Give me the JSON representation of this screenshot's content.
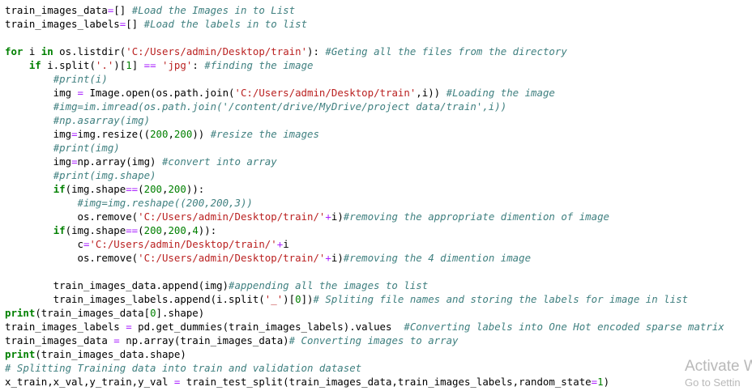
{
  "colors": {
    "background": "#ffffff",
    "comment": "#408080",
    "keyword": "#008000",
    "string": "#ba2121",
    "number": "#008000",
    "operator": "#aa22ff",
    "text": "#000000",
    "watermark": "#b9b9b9"
  },
  "code_lines": [
    [
      [
        "txt",
        "train_images_data"
      ],
      [
        "op",
        "="
      ],
      [
        "txt",
        "[] "
      ],
      [
        "cmt",
        "#Load the Images in to List"
      ]
    ],
    [
      [
        "txt",
        "train_images_labels"
      ],
      [
        "op",
        "="
      ],
      [
        "txt",
        "[] "
      ],
      [
        "cmt",
        "#Load the labels in to list"
      ]
    ],
    [],
    [
      [
        "kw",
        "for"
      ],
      [
        "txt",
        " i "
      ],
      [
        "kw",
        "in"
      ],
      [
        "txt",
        " os.listdir("
      ],
      [
        "str",
        "'C:/Users/admin/Desktop/train'"
      ],
      [
        "txt",
        "): "
      ],
      [
        "cmt",
        "#Geting all the files from the directory"
      ]
    ],
    [
      [
        "txt",
        "    "
      ],
      [
        "kw",
        "if"
      ],
      [
        "txt",
        " i.split("
      ],
      [
        "str",
        "'.'"
      ],
      [
        "txt",
        ")["
      ],
      [
        "num",
        "1"
      ],
      [
        "txt",
        "] "
      ],
      [
        "op",
        "=="
      ],
      [
        "txt",
        " "
      ],
      [
        "str",
        "'jpg'"
      ],
      [
        "txt",
        ": "
      ],
      [
        "cmt",
        "#finding the image"
      ]
    ],
    [
      [
        "txt",
        "        "
      ],
      [
        "cmt",
        "#print(i)"
      ]
    ],
    [
      [
        "txt",
        "        img "
      ],
      [
        "op",
        "="
      ],
      [
        "txt",
        " Image.open(os.path.join("
      ],
      [
        "str",
        "'C:/Users/admin/Desktop/train'"
      ],
      [
        "txt",
        ",i)) "
      ],
      [
        "cmt",
        "#Loading the image"
      ]
    ],
    [
      [
        "txt",
        "        "
      ],
      [
        "cmt",
        "#img=im.imread(os.path.join('/content/drive/MyDrive/project data/train',i))"
      ]
    ],
    [
      [
        "txt",
        "        "
      ],
      [
        "cmt",
        "#np.asarray(img)"
      ]
    ],
    [
      [
        "txt",
        "        img"
      ],
      [
        "op",
        "="
      ],
      [
        "txt",
        "img.resize(("
      ],
      [
        "num",
        "200"
      ],
      [
        "txt",
        ","
      ],
      [
        "num",
        "200"
      ],
      [
        "txt",
        ")) "
      ],
      [
        "cmt",
        "#resize the images"
      ]
    ],
    [
      [
        "txt",
        "        "
      ],
      [
        "cmt",
        "#print(img)"
      ]
    ],
    [
      [
        "txt",
        "        img"
      ],
      [
        "op",
        "="
      ],
      [
        "txt",
        "np.array(img) "
      ],
      [
        "cmt",
        "#convert into array"
      ]
    ],
    [
      [
        "txt",
        "        "
      ],
      [
        "cmt",
        "#print(img.shape)"
      ]
    ],
    [
      [
        "txt",
        "        "
      ],
      [
        "kw",
        "if"
      ],
      [
        "txt",
        "(img.shape"
      ],
      [
        "op",
        "=="
      ],
      [
        "txt",
        "("
      ],
      [
        "num",
        "200"
      ],
      [
        "txt",
        ","
      ],
      [
        "num",
        "200"
      ],
      [
        "txt",
        "))"
      ],
      [
        "txt",
        ":"
      ]
    ],
    [
      [
        "txt",
        "            "
      ],
      [
        "cmt",
        "#img=img.reshape((200,200,3))"
      ]
    ],
    [
      [
        "txt",
        "            os.remove("
      ],
      [
        "str",
        "'C:/Users/admin/Desktop/train/'"
      ],
      [
        "op",
        "+"
      ],
      [
        "txt",
        "i)"
      ],
      [
        "cmt",
        "#removing the appropriate dimention of image"
      ]
    ],
    [
      [
        "txt",
        "        "
      ],
      [
        "kw",
        "if"
      ],
      [
        "txt",
        "(img.shape"
      ],
      [
        "op",
        "=="
      ],
      [
        "txt",
        "("
      ],
      [
        "num",
        "200"
      ],
      [
        "txt",
        ","
      ],
      [
        "num",
        "200"
      ],
      [
        "txt",
        ","
      ],
      [
        "num",
        "4"
      ],
      [
        "txt",
        "))"
      ],
      [
        "txt",
        ":"
      ]
    ],
    [
      [
        "txt",
        "            c"
      ],
      [
        "op",
        "="
      ],
      [
        "str",
        "'C:/Users/admin/Desktop/train/'"
      ],
      [
        "op",
        "+"
      ],
      [
        "txt",
        "i"
      ]
    ],
    [
      [
        "txt",
        "            os.remove("
      ],
      [
        "str",
        "'C:/Users/admin/Desktop/train/'"
      ],
      [
        "op",
        "+"
      ],
      [
        "txt",
        "i)"
      ],
      [
        "cmt",
        "#removing the 4 dimention image"
      ]
    ],
    [],
    [
      [
        "txt",
        "        train_images_data.append(img)"
      ],
      [
        "cmt",
        "#appending all the images to list"
      ]
    ],
    [
      [
        "txt",
        "        train_images_labels.append(i.split("
      ],
      [
        "str",
        "'_'"
      ],
      [
        "txt",
        ")["
      ],
      [
        "num",
        "0"
      ],
      [
        "txt",
        "])"
      ],
      [
        "cmt",
        "# Spliting file names and storing the labels for image in list"
      ]
    ],
    [
      [
        "kw",
        "print"
      ],
      [
        "txt",
        "(train_images_data["
      ],
      [
        "num",
        "0"
      ],
      [
        "txt",
        "].shape)"
      ]
    ],
    [
      [
        "txt",
        "train_images_labels "
      ],
      [
        "op",
        "="
      ],
      [
        "txt",
        " pd.get_dummies(train_images_labels).values  "
      ],
      [
        "cmt",
        "#Converting labels into One Hot encoded sparse matrix"
      ]
    ],
    [
      [
        "txt",
        "train_images_data "
      ],
      [
        "op",
        "="
      ],
      [
        "txt",
        " np.array(train_images_data)"
      ],
      [
        "cmt",
        "# Converting images to array"
      ]
    ],
    [
      [
        "kw",
        "print"
      ],
      [
        "txt",
        "(train_images_data.shape)"
      ]
    ],
    [
      [
        "cmt",
        "# Splitting Training data into train and validation dataset"
      ]
    ],
    [
      [
        "txt",
        "x_train,x_val,y_train,y_val "
      ],
      [
        "op",
        "="
      ],
      [
        "txt",
        " train_test_split(train_images_data,train_images_labels,random_state"
      ],
      [
        "op",
        "="
      ],
      [
        "num",
        "1"
      ],
      [
        "txt",
        ")"
      ]
    ]
  ],
  "watermark": {
    "line1": "Activate W",
    "line2": "Go to Settin"
  }
}
